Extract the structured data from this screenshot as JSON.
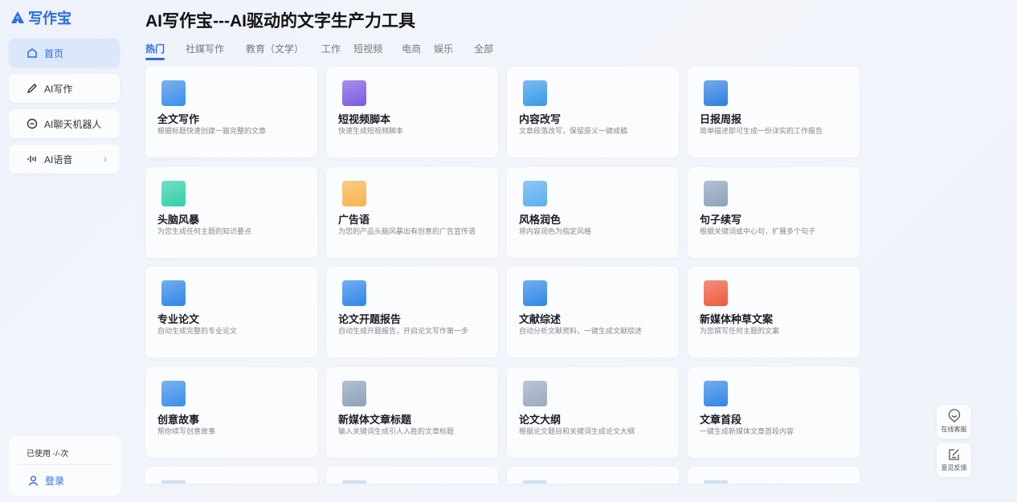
{
  "app": {
    "logo_text": "写作宝",
    "title": "AI写作宝---AI驱动的文字生产力工具"
  },
  "sidebar": {
    "items": [
      {
        "label": "首页",
        "icon": "home-icon"
      },
      {
        "label": "AI写作",
        "icon": "pen-icon"
      },
      {
        "label": "AI聊天机器人",
        "icon": "chat-icon"
      },
      {
        "label": "AI语音",
        "icon": "voice-icon"
      }
    ],
    "usage": "已使用 -/-次",
    "login": "登录"
  },
  "tabs": [
    "热门",
    "社媒写作",
    "教育（文学）",
    "工作",
    "短视频",
    "电商",
    "娱乐",
    "全部"
  ],
  "cards": [
    {
      "title": "全文写作",
      "desc": "根据标题快速创建一篇完整的文章",
      "color": "#3a8ee8"
    },
    {
      "title": "短视频脚本",
      "desc": "快速生成短视频脚本",
      "color": "#7a5ae0"
    },
    {
      "title": "内容改写",
      "desc": "文章段落改写，保留原义一键成稿",
      "color": "#3a9ae8"
    },
    {
      "title": "日报周报",
      "desc": "简单描述即可生成一份详实的工作报告",
      "color": "#2f7fe0"
    },
    {
      "title": "头脑风暴",
      "desc": "为您生成任何主题的知识要点",
      "color": "#2fd0a8"
    },
    {
      "title": "广告语",
      "desc": "为您的产品头脑风暴出有创意的广告宣传语",
      "color": "#f7b44a"
    },
    {
      "title": "风格润色",
      "desc": "将内容润色为指定风格",
      "color": "#5aaef0"
    },
    {
      "title": "句子续写",
      "desc": "根据关键词或中心句，扩展多个句子",
      "color": "#8ea2bb"
    },
    {
      "title": "专业论文",
      "desc": "自动生成完整的专业论文",
      "color": "#2f86e8"
    },
    {
      "title": "论文开题报告",
      "desc": "自动生成开题报告，开启论文写作第一步",
      "color": "#2f86e8"
    },
    {
      "title": "文献综述",
      "desc": "自动分析文献资料，一键生成文献综述",
      "color": "#2f86e8"
    },
    {
      "title": "新媒体种草文案",
      "desc": "为您撰写任何主题的文案",
      "color": "#ee5a3c"
    },
    {
      "title": "创意故事",
      "desc": "帮你续写创意故事",
      "color": "#3a8ee8"
    },
    {
      "title": "新媒体文章标题",
      "desc": "输入关键词生成引人入胜的文章标题",
      "color": "#8ea2bb"
    },
    {
      "title": "论文大纲",
      "desc": "根据论文题目和关键词生成论文大纲",
      "color": "#9aaac0"
    },
    {
      "title": "文章首段",
      "desc": "一键生成新媒体文章首段内容",
      "color": "#2f86e8"
    }
  ],
  "float": {
    "service": "在线客服",
    "feedback": "意见反馈"
  }
}
